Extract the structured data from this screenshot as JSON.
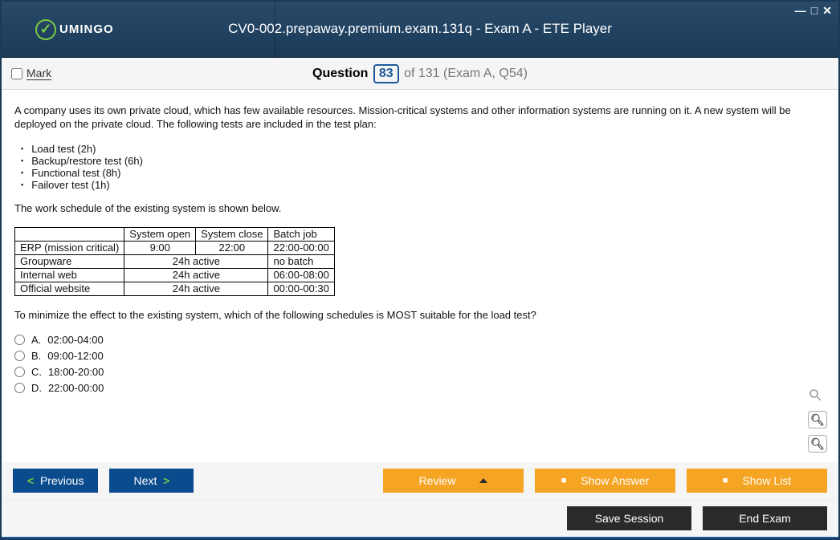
{
  "logo": "UMINGO",
  "title": "CV0-002.prepaway.premium.exam.131q - Exam A - ETE Player",
  "mark_label": "Mark",
  "question_label": "Question",
  "question_num": "83",
  "question_rest": "of 131 (Exam A, Q54)",
  "intro": "A company uses its own private cloud, which has few available resources. Mission-critical systems and other information systems are running on it. A new system will be deployed on the private cloud. The following tests are included in the test plan:",
  "tests": [
    "Load test (2h)",
    "Backup/restore test (6h)",
    "Functional test (8h)",
    "Failover test (1h)"
  ],
  "sched_label": "The work schedule of the existing system is shown below.",
  "table": {
    "headers": [
      "",
      "System open",
      "System close",
      "Batch job"
    ],
    "rows": [
      {
        "name": "ERP (mission critical)",
        "open": "9:00",
        "close": "22:00",
        "batch": "22:00-00:00",
        "span24": false
      },
      {
        "name": "Groupware",
        "span24": true,
        "span_text": "24h active",
        "batch": "no batch"
      },
      {
        "name": "Internal web",
        "span24": true,
        "span_text": "24h active",
        "batch": "06:00-08:00"
      },
      {
        "name": "Official website",
        "span24": true,
        "span_text": "24h active",
        "batch": "00:00-00:30"
      }
    ]
  },
  "question2": "To minimize the effect to the existing system, which of the following schedules is MOST suitable for the load test?",
  "options": [
    {
      "letter": "A.",
      "text": "02:00-04:00"
    },
    {
      "letter": "B.",
      "text": "09:00-12:00"
    },
    {
      "letter": "C.",
      "text": "18:00-20:00"
    },
    {
      "letter": "D.",
      "text": "22:00-00:00"
    }
  ],
  "btns": {
    "previous": "Previous",
    "next": "Next",
    "review": "Review",
    "show_answer": "Show Answer",
    "show_list": "Show List",
    "save_session": "Save Session",
    "end_exam": "End Exam"
  }
}
